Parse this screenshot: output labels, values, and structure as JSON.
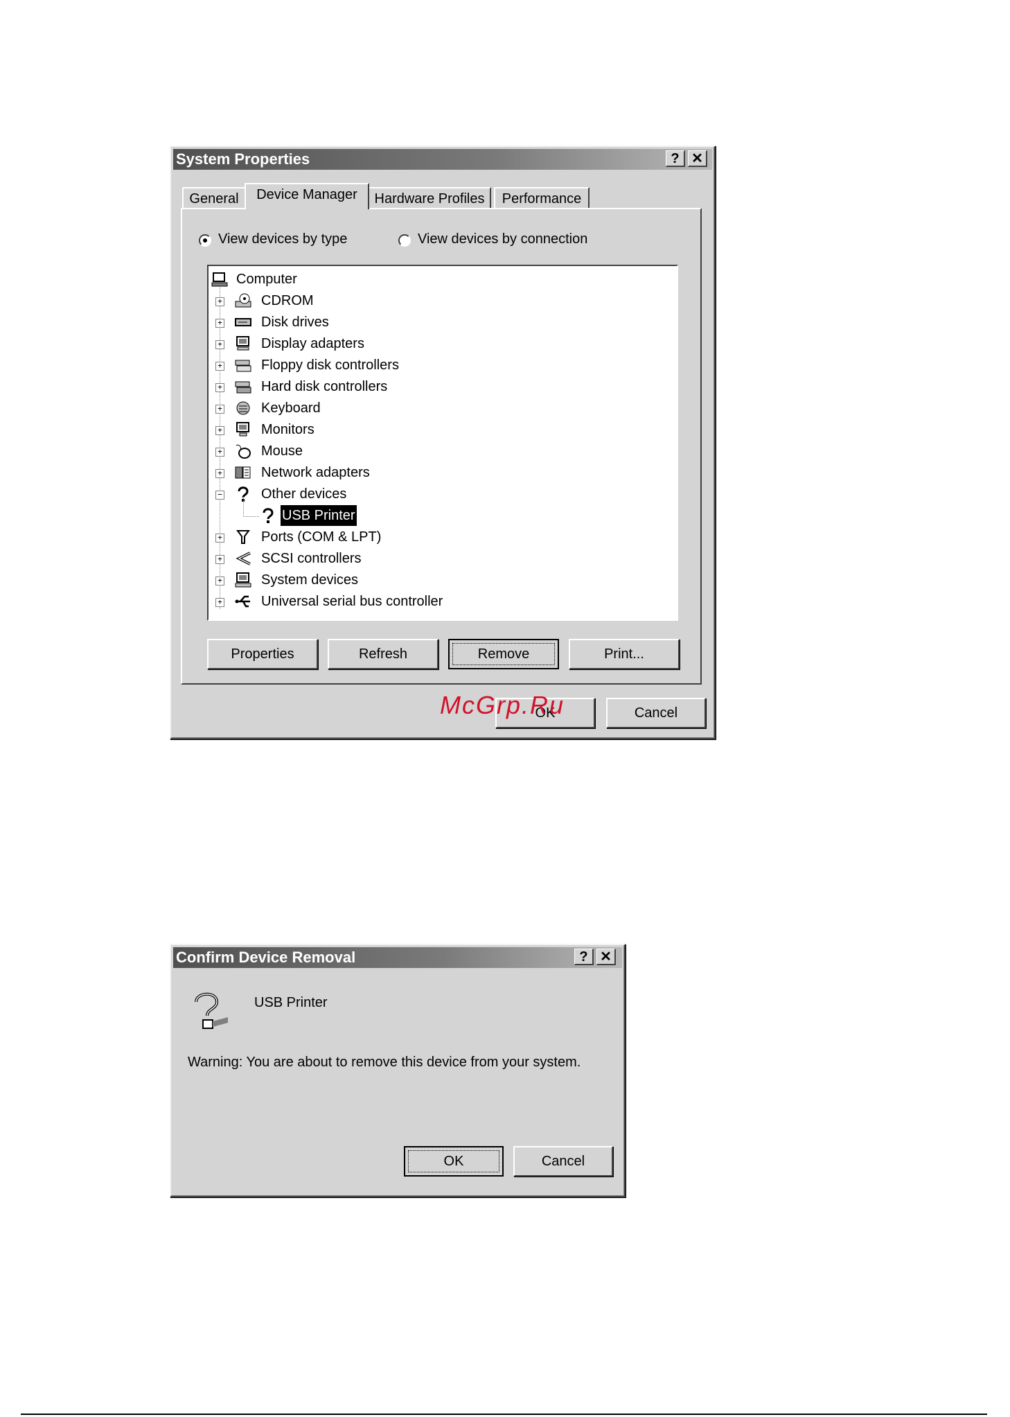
{
  "system_properties": {
    "title": "System Properties",
    "help_label": "?",
    "close_label": "✕",
    "tabs": [
      {
        "label": "General"
      },
      {
        "label": "Device Manager"
      },
      {
        "label": "Hardware Profiles"
      },
      {
        "label": "Performance"
      }
    ],
    "radio_by_type": "View devices by type",
    "radio_by_connection": "View devices by connection",
    "tree": {
      "root": "Computer",
      "items": [
        {
          "label": "CDROM",
          "icon": "cdrom-icon"
        },
        {
          "label": "Disk drives",
          "icon": "disk-drive-icon"
        },
        {
          "label": "Display adapters",
          "icon": "display-adapter-icon"
        },
        {
          "label": "Floppy disk controllers",
          "icon": "floppy-controller-icon"
        },
        {
          "label": "Hard disk controllers",
          "icon": "hard-disk-controller-icon"
        },
        {
          "label": "Keyboard",
          "icon": "keyboard-icon"
        },
        {
          "label": "Monitors",
          "icon": "monitor-icon"
        },
        {
          "label": "Mouse",
          "icon": "mouse-icon"
        },
        {
          "label": "Network adapters",
          "icon": "network-adapter-icon"
        },
        {
          "label": "Other devices",
          "icon": "question-mark-icon"
        },
        {
          "label": "USB Printer",
          "icon": "question-mark-icon"
        },
        {
          "label": "Ports (COM & LPT)",
          "icon": "port-icon"
        },
        {
          "label": "SCSI controllers",
          "icon": "scsi-icon"
        },
        {
          "label": "System devices",
          "icon": "system-device-icon"
        },
        {
          "label": "Universal serial bus controller",
          "icon": "usb-icon"
        }
      ]
    },
    "buttons": {
      "properties": "Properties",
      "refresh": "Refresh",
      "remove": "Remove",
      "print": "Print...",
      "ok": "OK",
      "cancel": "Cancel"
    }
  },
  "confirm_removal": {
    "title": "Confirm Device Removal",
    "help_label": "?",
    "close_label": "✕",
    "device_name": "USB Printer",
    "warning": "Warning: You are about to remove this device from your system.",
    "ok": "OK",
    "cancel": "Cancel"
  },
  "watermark": "McGrp.Ru",
  "colors": {
    "dialog_face": "#d4d4d4",
    "watermark": "#d0122a"
  }
}
